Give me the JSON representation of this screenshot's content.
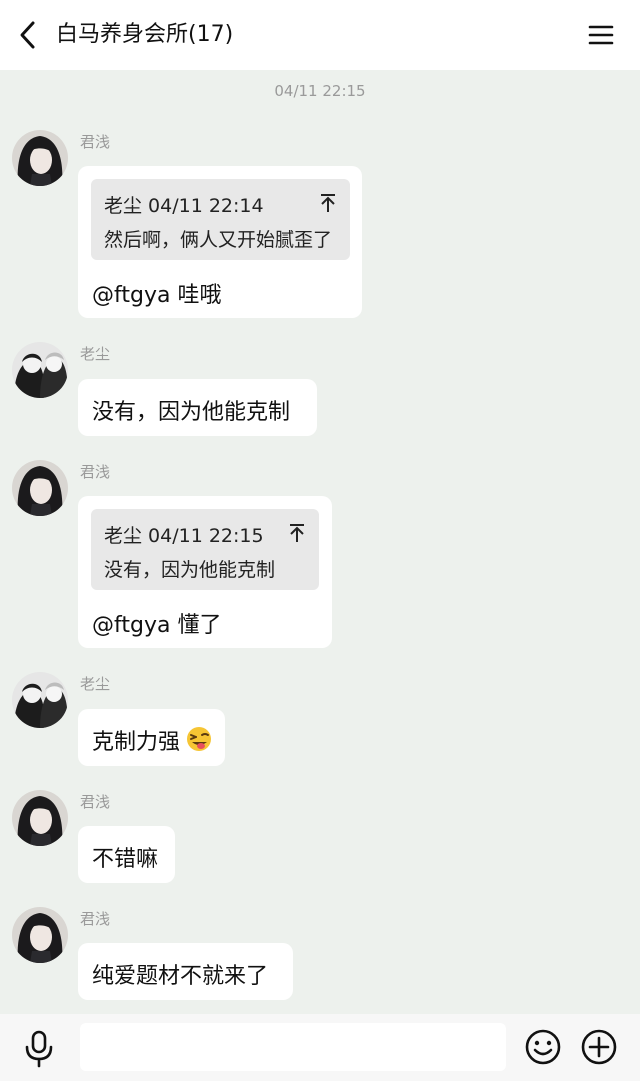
{
  "header": {
    "title": "白马养身会所(17)",
    "back_icon": "chevron-left-icon",
    "menu_icon": "hamburger-menu-icon"
  },
  "timestamp": "04/11 22:15",
  "messages": [
    {
      "sender": "君浅",
      "avatar": "girl-avatar",
      "quote": {
        "header": "老尘 04/11 22:14",
        "body": "然后啊，俩人又开始腻歪了",
        "jump_icon": "jump-to-top-icon"
      },
      "text": "@ftgya 哇哦"
    },
    {
      "sender": "老尘",
      "avatar": "couple-avatar",
      "text": "没有，因为他能克制"
    },
    {
      "sender": "君浅",
      "avatar": "girl-avatar",
      "quote": {
        "header": "老尘 04/11 22:15",
        "body": "没有，因为他能克制",
        "jump_icon": "jump-to-top-icon"
      },
      "text": "@ftgya 懂了"
    },
    {
      "sender": "老尘",
      "avatar": "couple-avatar",
      "text": "克制力强",
      "emoji": "grinning-tongue-emoji"
    },
    {
      "sender": "君浅",
      "avatar": "girl-avatar",
      "text": "不错嘛"
    },
    {
      "sender": "君浅",
      "avatar": "girl-avatar",
      "text": "纯爱题材不就来了"
    }
  ],
  "input_bar": {
    "value": "",
    "mic_icon": "microphone-icon",
    "emoji_icon": "smiley-icon",
    "plus_icon": "plus-circle-icon"
  },
  "colors": {
    "chat_background": "#edf1ed",
    "bubble": "#ffffff",
    "quote_background": "#e8e8e8",
    "meta_text": "#9a9a9a"
  }
}
